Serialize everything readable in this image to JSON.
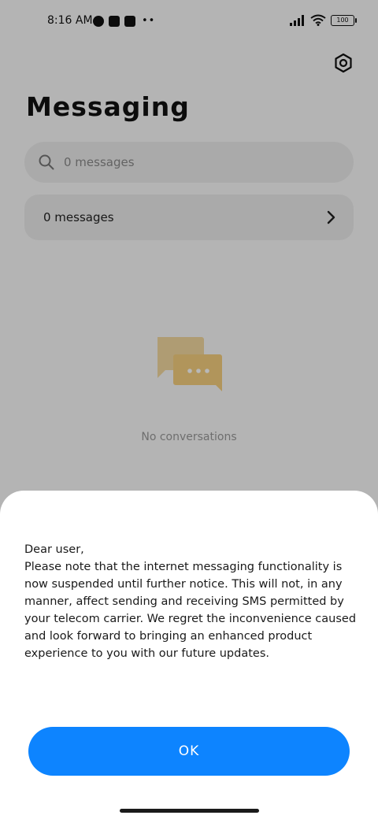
{
  "status_bar": {
    "time": "8:16 AM",
    "battery": "100"
  },
  "header": {
    "title": "Messaging",
    "settings_icon": "settings-hex-icon"
  },
  "search": {
    "placeholder": "0 messages",
    "icon": "search-icon"
  },
  "messages_row": {
    "label": "0 messages",
    "icon": "chevron-right-icon"
  },
  "empty_state": {
    "icon": "chat-bubbles-icon",
    "text": "No conversations"
  },
  "dialog": {
    "message": "Dear user,\nPlease note that the internet messaging functionality is now suspended until further notice. This will not, in any manner, affect sending and receiving SMS permitted by your telecom carrier. We regret the inconvenience caused and look forward to bringing an enhanced product experience to you with our future updates.",
    "ok_label": "OK"
  },
  "colors": {
    "accent": "#0d84ff",
    "empty_icon_back": "#f3d9a0",
    "empty_icon_front": "#f6cf7e"
  }
}
